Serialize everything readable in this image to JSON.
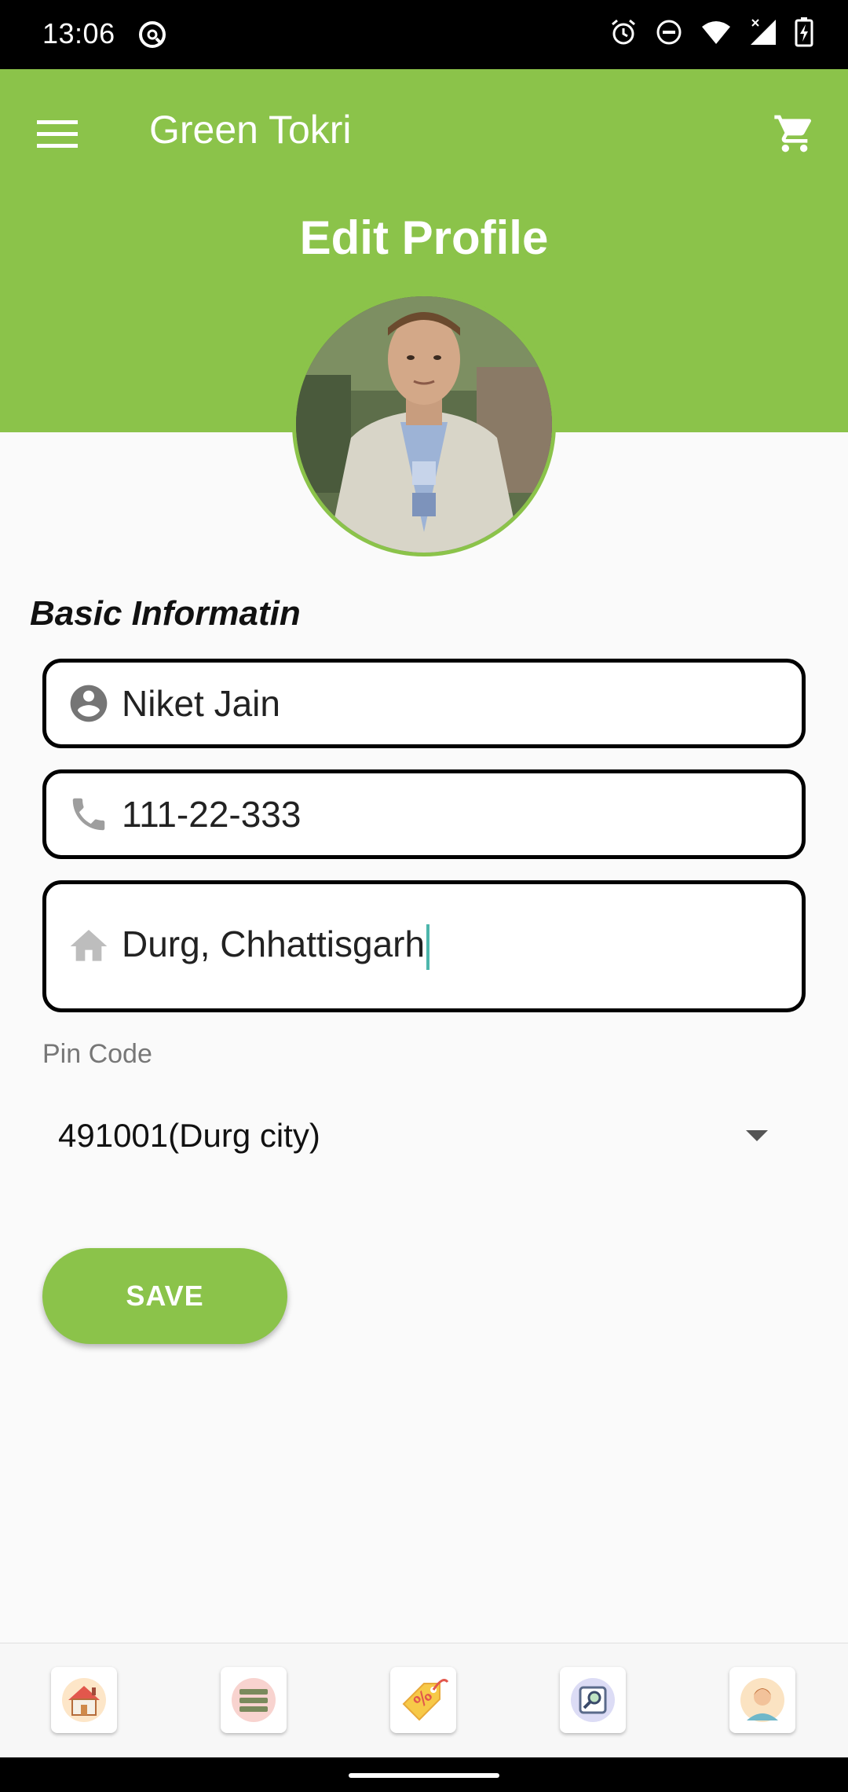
{
  "status_bar": {
    "time": "13:06",
    "left_icon": "vpn-key-icon",
    "right_icons": [
      "alarm-icon",
      "do-not-disturb-icon",
      "wifi-icon",
      "signal-icon",
      "battery-charging-icon"
    ]
  },
  "header": {
    "app_title": "Green Tokri",
    "page_title": "Edit Profile",
    "menu_icon": "hamburger-menu-icon",
    "cart_icon": "cart-icon",
    "color": "#8bc34a"
  },
  "profile": {
    "avatar": "profile-photo"
  },
  "form": {
    "section_title": "Basic Informatin",
    "name": {
      "value": "Niket Jain",
      "icon": "account-circle-icon"
    },
    "phone": {
      "value": "111-22-333",
      "icon": "phone-icon"
    },
    "address": {
      "value": "Durg, Chhattisgarh",
      "icon": "home-icon"
    },
    "pin_code": {
      "label": "Pin Code",
      "selected": "491001(Durg city)"
    },
    "save_label": "SAVE"
  },
  "bottom_nav": {
    "items": [
      {
        "icon": "home-nav-icon"
      },
      {
        "icon": "list-nav-icon"
      },
      {
        "icon": "offers-tag-icon"
      },
      {
        "icon": "search-nav-icon"
      },
      {
        "icon": "profile-nav-icon"
      }
    ]
  }
}
